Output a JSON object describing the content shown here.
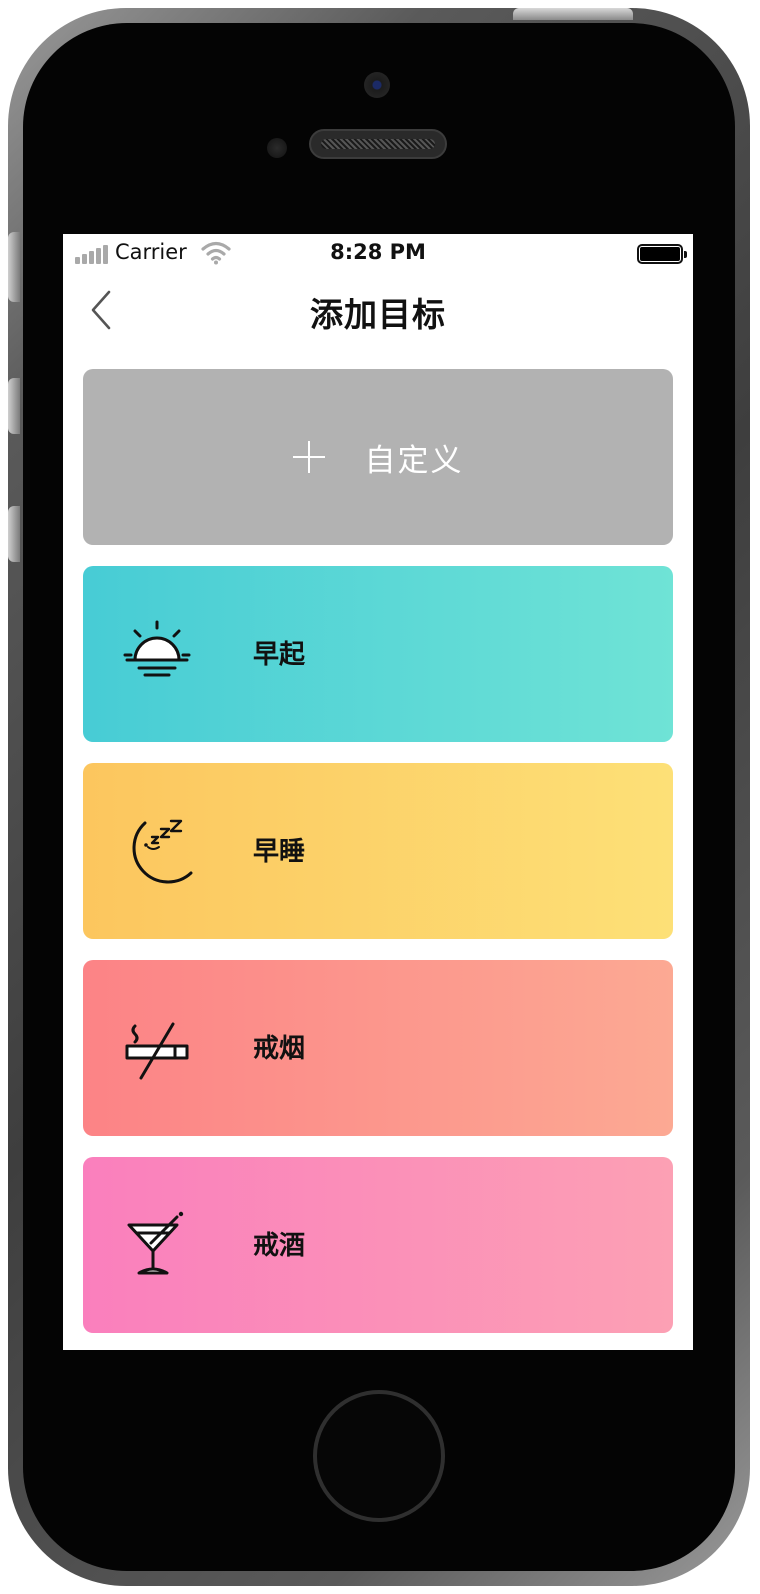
{
  "status_bar": {
    "carrier": "Carrier",
    "time": "8:28 PM",
    "signal_icon": "cellular-signal-icon",
    "wifi_icon": "wifi-icon",
    "battery_icon": "battery-icon"
  },
  "nav": {
    "back_icon": "chevron-left-icon",
    "title": "添加目标"
  },
  "custom_card": {
    "icon": "plus-icon",
    "label": "自定义",
    "color": "#b2b2b2"
  },
  "goals": [
    {
      "label": "早起",
      "icon": "sunrise-icon",
      "colors": [
        "#47ccd5",
        "#6fe3d6"
      ]
    },
    {
      "label": "早睡",
      "icon": "moon-sleep-icon",
      "colors": [
        "#fcc65e",
        "#fde077"
      ]
    },
    {
      "label": "戒烟",
      "icon": "no-smoking-icon",
      "colors": [
        "#fc8386",
        "#fca993"
      ]
    },
    {
      "label": "戒酒",
      "icon": "cocktail-icon",
      "colors": [
        "#fa7fbd",
        "#fca0b4"
      ]
    }
  ]
}
